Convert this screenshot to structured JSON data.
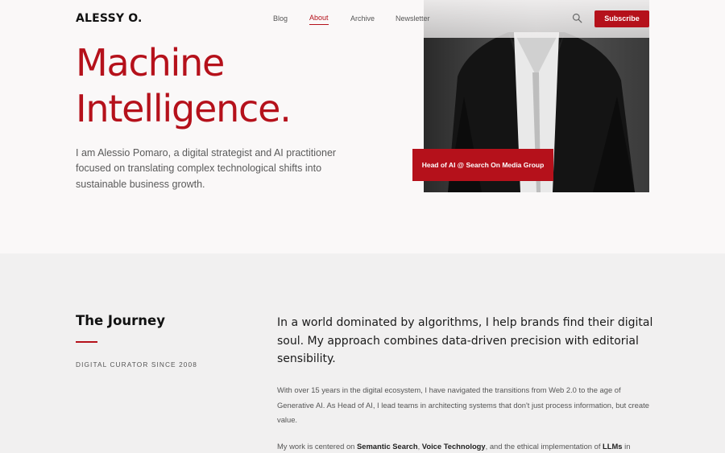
{
  "header": {
    "logo": "ALESSY O.",
    "nav": [
      {
        "label": "Blog",
        "active": false
      },
      {
        "label": "About",
        "active": true
      },
      {
        "label": "Archive",
        "active": false
      },
      {
        "label": "Newsletter",
        "active": false
      }
    ],
    "search_icon": "search-icon",
    "subscribe_label": "Subscribe"
  },
  "hero": {
    "title_line1": "Machine",
    "title_line2": "Intelligence.",
    "intro": "I am Alessio Pomaro, a digital strategist and AI practitioner focused on translating complex technological shifts into sustainable business growth.",
    "badge": "Head of AI @ Search On Media Group"
  },
  "journey": {
    "title": "The Journey",
    "subtitle": "DIGITAL CURATOR SINCE 2008",
    "lead": "In a world dominated by algorithms, I help brands find their digital soul. My approach combines data-driven precision with editorial sensibility.",
    "paragraph1": "With over 15 years in the digital ecosystem, I have navigated the transitions from Web 2.0 to the age of Generative AI. As Head of AI, I lead teams in architecting systems that don't just process information, but create value.",
    "paragraph2_prefix": "My work is centered on ",
    "paragraph2_term1": "Semantic Search",
    "paragraph2_sep1": ", ",
    "paragraph2_term2": "Voice Technology",
    "paragraph2_mid": ", and the ethical implementation of ",
    "paragraph2_term3": "LLMs",
    "paragraph2_suffix": " in"
  },
  "colors": {
    "accent": "#b5111b",
    "background": "#faf8f8",
    "section_background": "#f1f0f0"
  }
}
